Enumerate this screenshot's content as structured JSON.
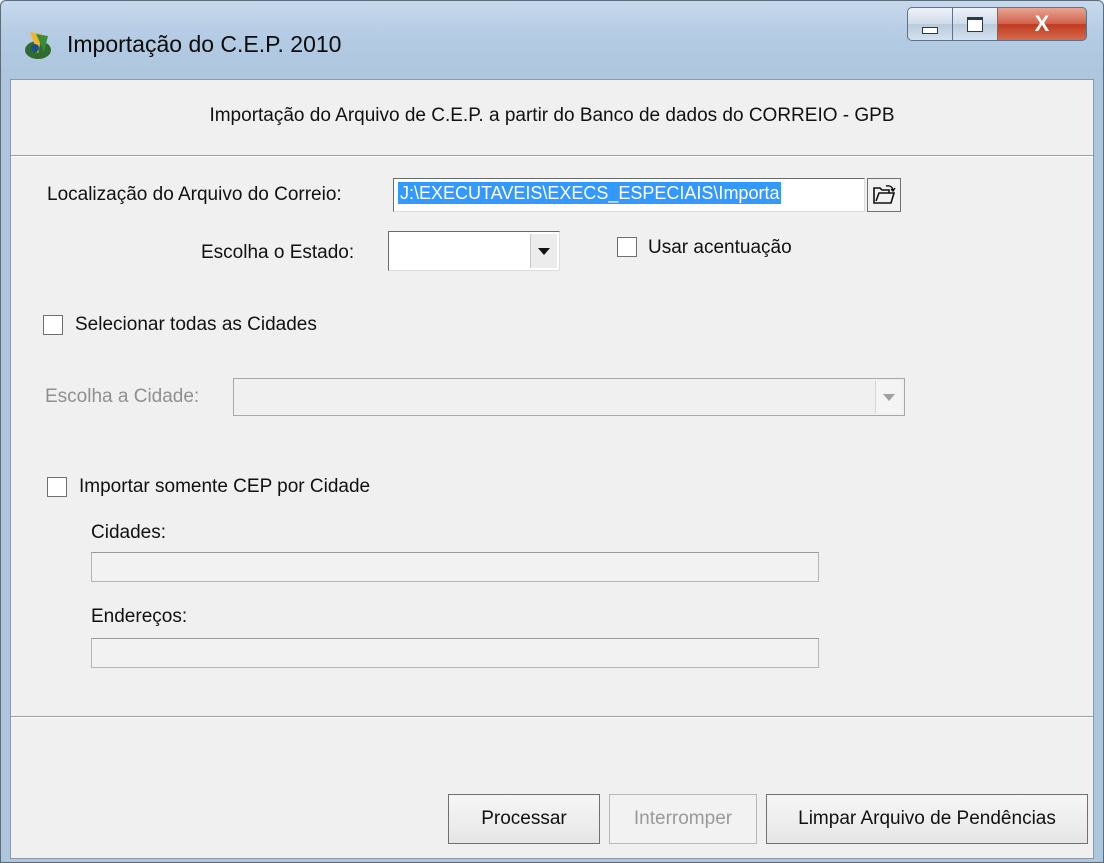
{
  "window": {
    "title": "Importação do C.E.P. 2010",
    "controls": {
      "minimize": "minimize-icon",
      "maximize": "maximize-icon",
      "close": "X"
    }
  },
  "header": {
    "text": "Importação do Arquivo de C.E.P.  a partir do Banco de dados do CORREIO - GPB"
  },
  "form": {
    "file_label": "Localização do Arquivo do Correio:",
    "file_value": "J:\\EXECUTAVEIS\\EXECS_ESPECIAIS\\Importa",
    "state_label": "Escolha o Estado:",
    "state_value": "",
    "accent_label": "Usar acentuação",
    "accent_checked": false,
    "select_all_label": "Selecionar todas as Cidades",
    "select_all_checked": false,
    "city_label": "Escolha a Cidade:",
    "city_value": "",
    "only_city_label": "Importar somente CEP por Cidade",
    "only_city_checked": false,
    "cities_label": "Cidades:",
    "addresses_label": "Endereços:"
  },
  "buttons": {
    "process": "Processar",
    "stop": "Interromper",
    "clear": "Limpar Arquivo de Pendências"
  }
}
